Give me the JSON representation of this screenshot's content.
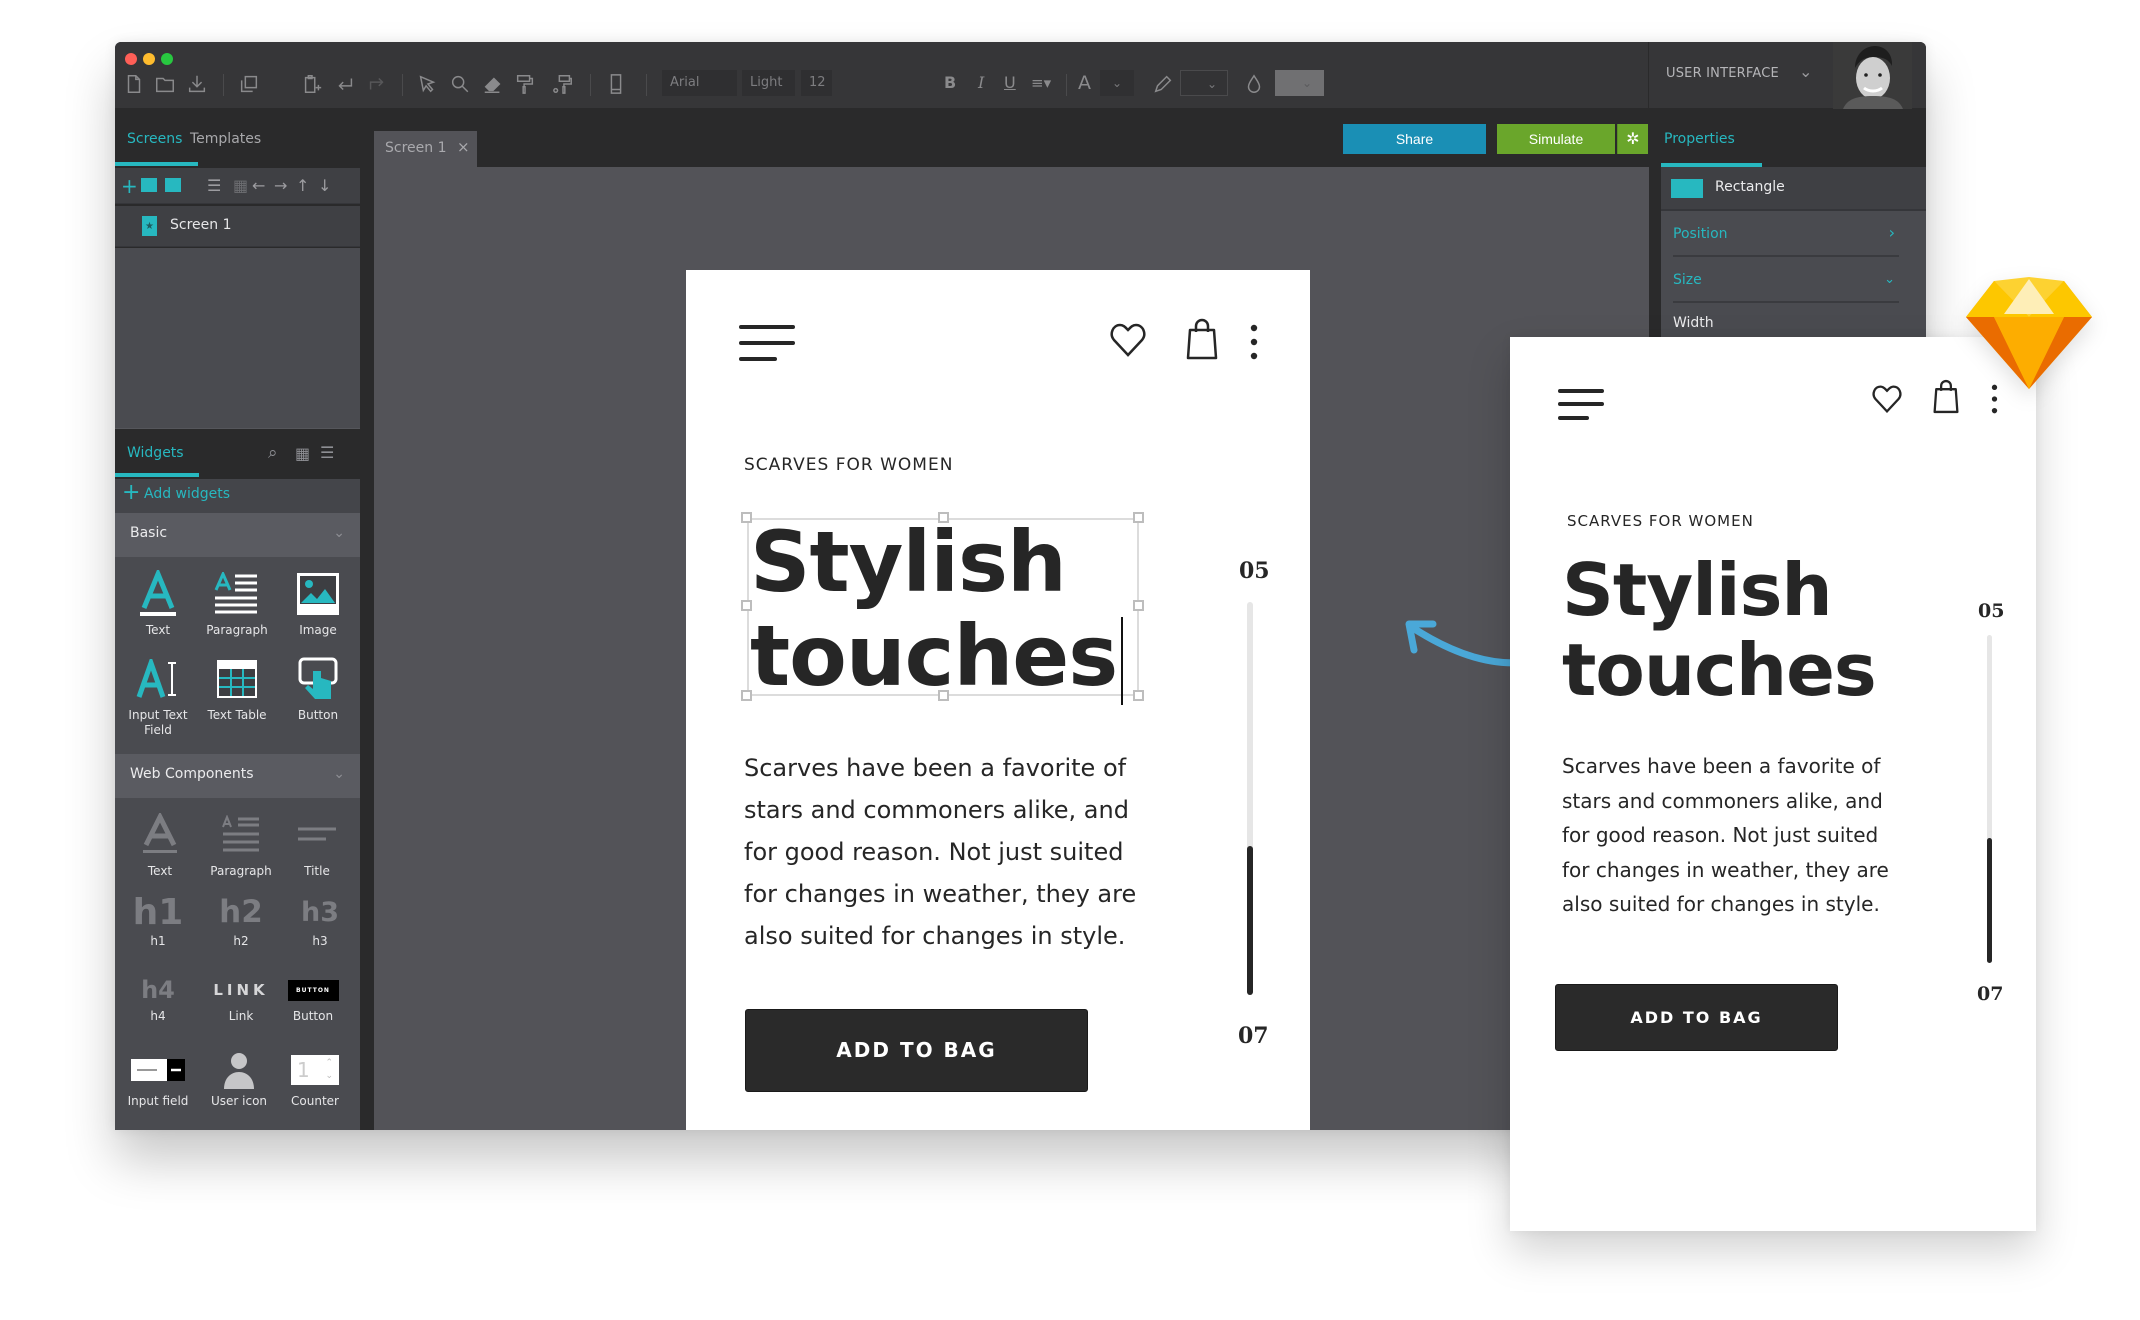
{
  "window": {
    "traffic_lights": {
      "close": "#ff5f57",
      "minimize": "#febc2e",
      "maximize": "#28c840"
    },
    "toolbar": {
      "icons": [
        "new-file-icon",
        "open-folder-icon",
        "download-icon",
        "duplicate-icon",
        "paste-add-icon",
        "undo-icon",
        "redo-icon",
        "pointer-icon",
        "zoom-icon",
        "eraser-icon",
        "paint-roller-icon",
        "style-roller-icon",
        "mobile-device-icon"
      ],
      "font_family": "Arial",
      "font_weight": "Light",
      "font_size": "12",
      "bold": "B",
      "italic": "I",
      "underline": "U",
      "align": "≡▾",
      "text_color_glyph": "A",
      "chevron": "⌄",
      "project_select": "USER INTERFACE"
    },
    "left_panel": {
      "tabs": [
        {
          "label": "Screens",
          "active": true
        },
        {
          "label": "Templates",
          "active": false
        }
      ],
      "screens": [
        {
          "label": "Screen 1"
        }
      ],
      "widgets_header": "Widgets",
      "add_widgets": "Add widgets",
      "categories": [
        {
          "label": "Basic",
          "items": [
            {
              "label": "Text",
              "icon": "text-icon"
            },
            {
              "label": "Paragraph",
              "icon": "paragraph-icon"
            },
            {
              "label": "Image",
              "icon": "image-icon"
            },
            {
              "label": "Input Text Field",
              "icon": "input-text-icon"
            },
            {
              "label": "Text Table",
              "icon": "table-icon"
            },
            {
              "label": "Button",
              "icon": "button-tap-icon"
            }
          ]
        },
        {
          "label": "Web Components",
          "items": [
            {
              "label": "Text",
              "icon": "text-icon",
              "glyph": "A"
            },
            {
              "label": "Paragraph",
              "icon": "paragraph-icon"
            },
            {
              "label": "Title",
              "icon": "title-icon"
            },
            {
              "label": "h1",
              "icon": "h1-icon",
              "glyph": "h1"
            },
            {
              "label": "h2",
              "icon": "h2-icon",
              "glyph": "h2"
            },
            {
              "label": "h3",
              "icon": "h3-icon",
              "glyph": "h3"
            },
            {
              "label": "h4",
              "icon": "h4-icon",
              "glyph": "h4"
            },
            {
              "label": "Link",
              "icon": "link-icon",
              "glyph": "LINK"
            },
            {
              "label": "Button",
              "icon": "button-icon",
              "glyph": "BUTTON"
            },
            {
              "label": "Input field",
              "icon": "input-field-icon"
            },
            {
              "label": "User icon",
              "icon": "user-icon"
            },
            {
              "label": "Counter",
              "icon": "counter-icon",
              "glyph": "1"
            }
          ]
        }
      ]
    },
    "canvas": {
      "tab_label": "Screen 1",
      "tab_close": "×",
      "share_label": "Share",
      "simulate_label": "Simulate",
      "settings_glyph": "✲"
    },
    "right_panel": {
      "tab": "Properties",
      "element": "Rectangle",
      "element_color": "#27b8c0",
      "sections": [
        {
          "label": "Position",
          "state": "collapsed"
        },
        {
          "label": "Size",
          "state": "expanded"
        }
      ],
      "field_label": "Width"
    }
  },
  "mockup": {
    "eyebrow": "SCARVES FOR WOMEN",
    "title_line1": "Stylish",
    "title_line2": "touches",
    "paragraph_lines": [
      "Scarves have been a favorite of",
      "stars and commoners alike, and",
      "for good reason. Not just suited",
      "for changes in weather, they are",
      "also suited for changes in style."
    ],
    "cta": "ADD TO BAG",
    "slider": {
      "start_label": "05",
      "end_label": "07",
      "progress": 0.38
    }
  },
  "colors": {
    "accent": "#27b8c0",
    "share": "#1a8fb5",
    "simulate": "#6aa62b",
    "arrow": "#4aa8d8",
    "sketch_logo": "#fdad00"
  }
}
